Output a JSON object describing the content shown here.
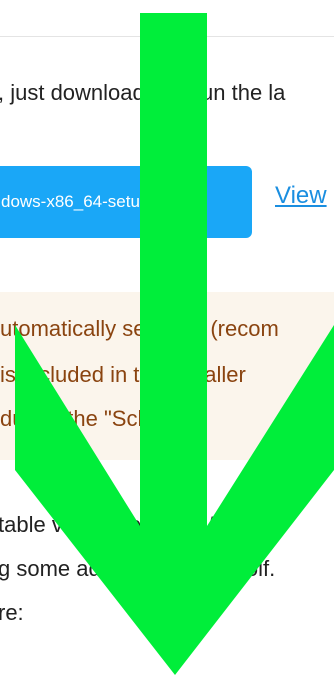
{
  "intro": {
    "text": ", just download and run the la"
  },
  "download": {
    "button_label": "dows-x86_64-setup.exe",
    "view_link": "View"
  },
  "note": {
    "line1": "utomatically selected (recom",
    "line2": "is included in the installer",
    "line3": "during the \"Scho"
  },
  "body": {
    "line1": "table version of LibreWolf, us",
    "line2": "g some additional LibreWolf.",
    "line3": "re:"
  },
  "overlay": {
    "icon": "down-arrow-icon",
    "color": "#00ee3a"
  }
}
